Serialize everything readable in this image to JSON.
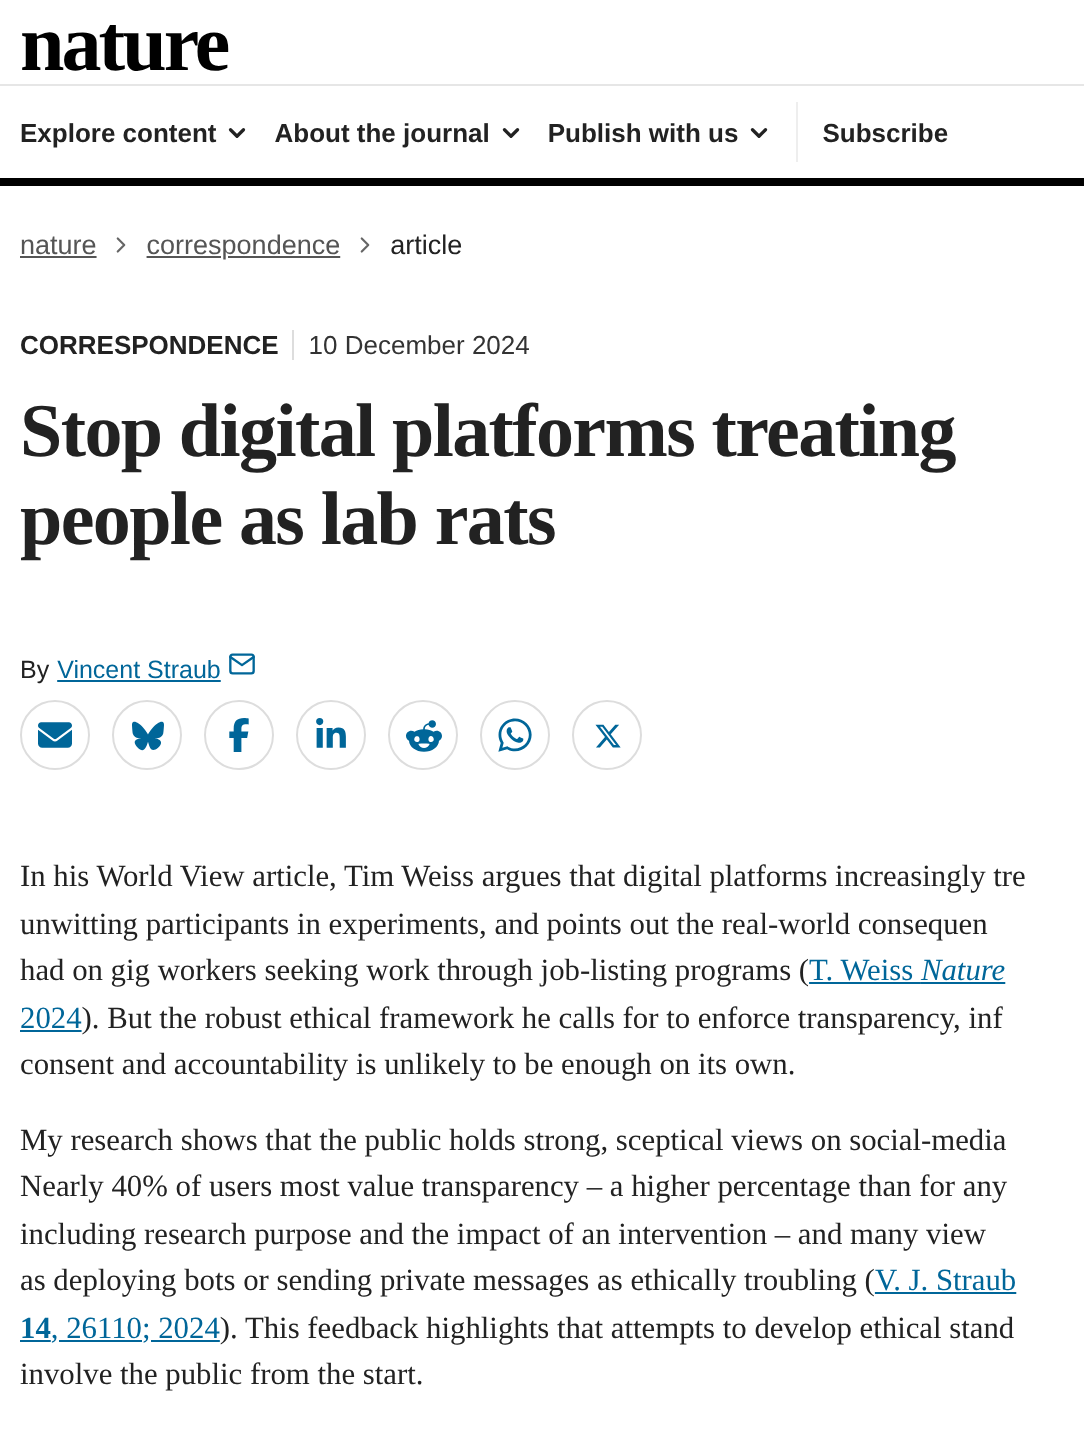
{
  "logo": "nature",
  "nav": [
    {
      "label": "Explore content",
      "dropdown": true
    },
    {
      "label": "About the journal",
      "dropdown": true
    },
    {
      "label": "Publish with us",
      "dropdown": true
    },
    {
      "label": "Subscribe",
      "dropdown": false
    }
  ],
  "breadcrumb": [
    {
      "label": "nature",
      "kind": "link"
    },
    {
      "label": "correspondence",
      "kind": "link"
    },
    {
      "label": "article",
      "kind": "current"
    }
  ],
  "article_type": "CORRESPONDENCE",
  "date": "10 December 2024",
  "title": "Stop digital platforms treating people as lab rats",
  "byline": {
    "prefix": "By",
    "author": "Vincent Straub"
  },
  "share": [
    {
      "kind": "email"
    },
    {
      "kind": "bluesky"
    },
    {
      "kind": "facebook"
    },
    {
      "kind": "linkedin"
    },
    {
      "kind": "reddit"
    },
    {
      "kind": "whatsapp"
    },
    {
      "kind": "x"
    }
  ],
  "paragraphs": [
    [
      [
        {
          "text": "In his World View article, Tim Weiss argues that digital platforms increasingly tre",
          "link": false
        }
      ],
      [
        {
          "text": "unwitting participants in experiments, and points out the real-world consequen",
          "link": false
        }
      ],
      [
        {
          "text": "had on gig workers seeking work through job-listing programs (",
          "link": false
        },
        {
          "text": "T. Weiss *Nature*",
          "link": true
        }
      ],
      [
        {
          "text": "2024",
          "link": true
        },
        {
          "text": "). But the robust ethical framework he calls for to enforce transparency, inf",
          "link": false
        }
      ],
      [
        {
          "text": "consent and accountability is unlikely to be enough on its own.",
          "link": false
        }
      ]
    ],
    [
      [
        {
          "text": "My research shows that the public holds strong, sceptical views on social-media",
          "link": false
        }
      ],
      [
        {
          "text": "Nearly 40% of users most value transparency – a higher percentage than for any",
          "link": false
        }
      ],
      [
        {
          "text": "including research purpose and the impact of an intervention – and many view",
          "link": false
        }
      ],
      [
        {
          "text": "as deploying bots or sending private messages as ethically troubling (",
          "link": false
        },
        {
          "text": "V. J. Straub",
          "link": true
        }
      ],
      [
        {
          "text": "**14**, 26110; 2024",
          "link": true
        },
        {
          "text": "). This feedback highlights that attempts to develop ethical stand",
          "link": false
        }
      ],
      [
        {
          "text": "involve the public from the start.",
          "link": false
        }
      ]
    ]
  ]
}
